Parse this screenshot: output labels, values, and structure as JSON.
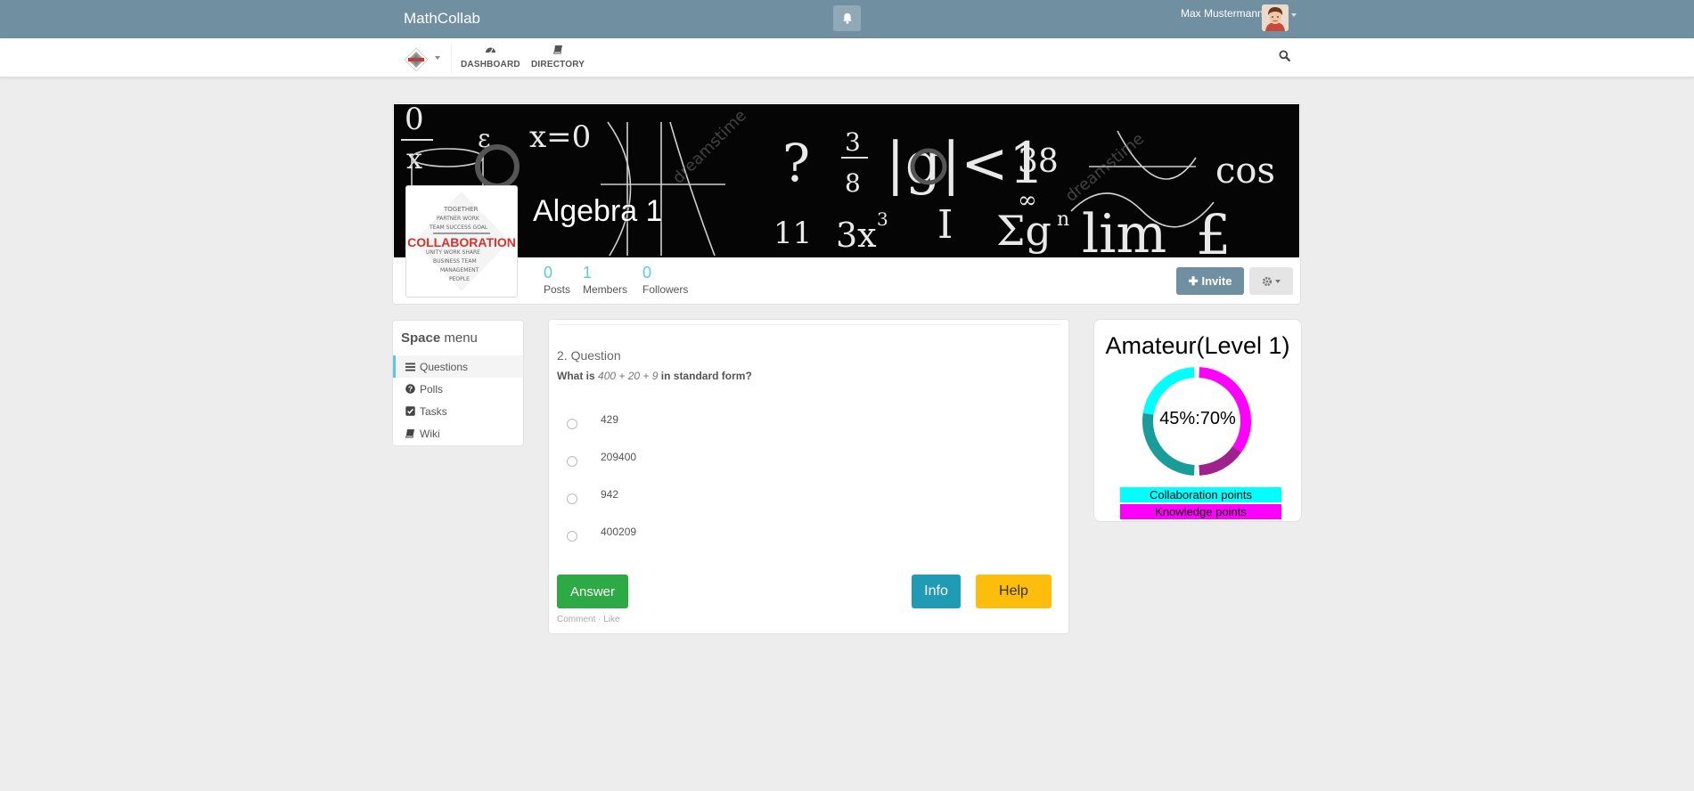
{
  "app": {
    "brand": "MathCollab"
  },
  "user": {
    "name": "Max Mustermann"
  },
  "nav": {
    "dashboard": "DASHBOARD",
    "directory": "DIRECTORY"
  },
  "space": {
    "title": "Algebra 1",
    "stats": [
      {
        "value": "0",
        "label": "Posts"
      },
      {
        "value": "1",
        "label": "Members"
      },
      {
        "value": "0",
        "label": "Followers"
      }
    ],
    "invite_label": "Invite",
    "logo_text": "COLLABORATION"
  },
  "space_menu": {
    "title_bold": "Space",
    "title_rest": "menu",
    "items": [
      {
        "label": "Questions",
        "icon": "list-icon",
        "active": true
      },
      {
        "label": "Polls",
        "icon": "question-circle-icon"
      },
      {
        "label": "Tasks",
        "icon": "checkbox-icon"
      },
      {
        "label": "Wiki",
        "icon": "book-icon"
      }
    ]
  },
  "question": {
    "heading": "2. Question",
    "text_prefix": "What is",
    "text_expr": "400 + 20 + 9",
    "text_suffix": "in standard form?",
    "options": [
      "429",
      "209400",
      "942",
      "400209"
    ],
    "answer_label": "Answer",
    "info_label": "Info",
    "help_label": "Help",
    "comment_link": "Comment",
    "like_link": "Like"
  },
  "level": {
    "title": "Amateur(Level 1)",
    "collaboration_percent": 45,
    "knowledge_percent": 70,
    "ratio_label": "45%:70%",
    "legend": [
      {
        "label": "Collaboration points",
        "color": "#00ffff"
      },
      {
        "label": "Knowledge points",
        "color": "#ff00ff"
      }
    ],
    "colors": {
      "collab_fill": "#00ffff",
      "collab_track": "#1a9c9a",
      "knowledge_fill": "#ff00ff",
      "knowledge_track": "#a0208e"
    }
  },
  "colors": {
    "topbar": "#708fa0",
    "accent": "#5bc8e2",
    "answer": "#2eaa44",
    "info": "#1f9bb5",
    "help": "#fcbd0d"
  }
}
